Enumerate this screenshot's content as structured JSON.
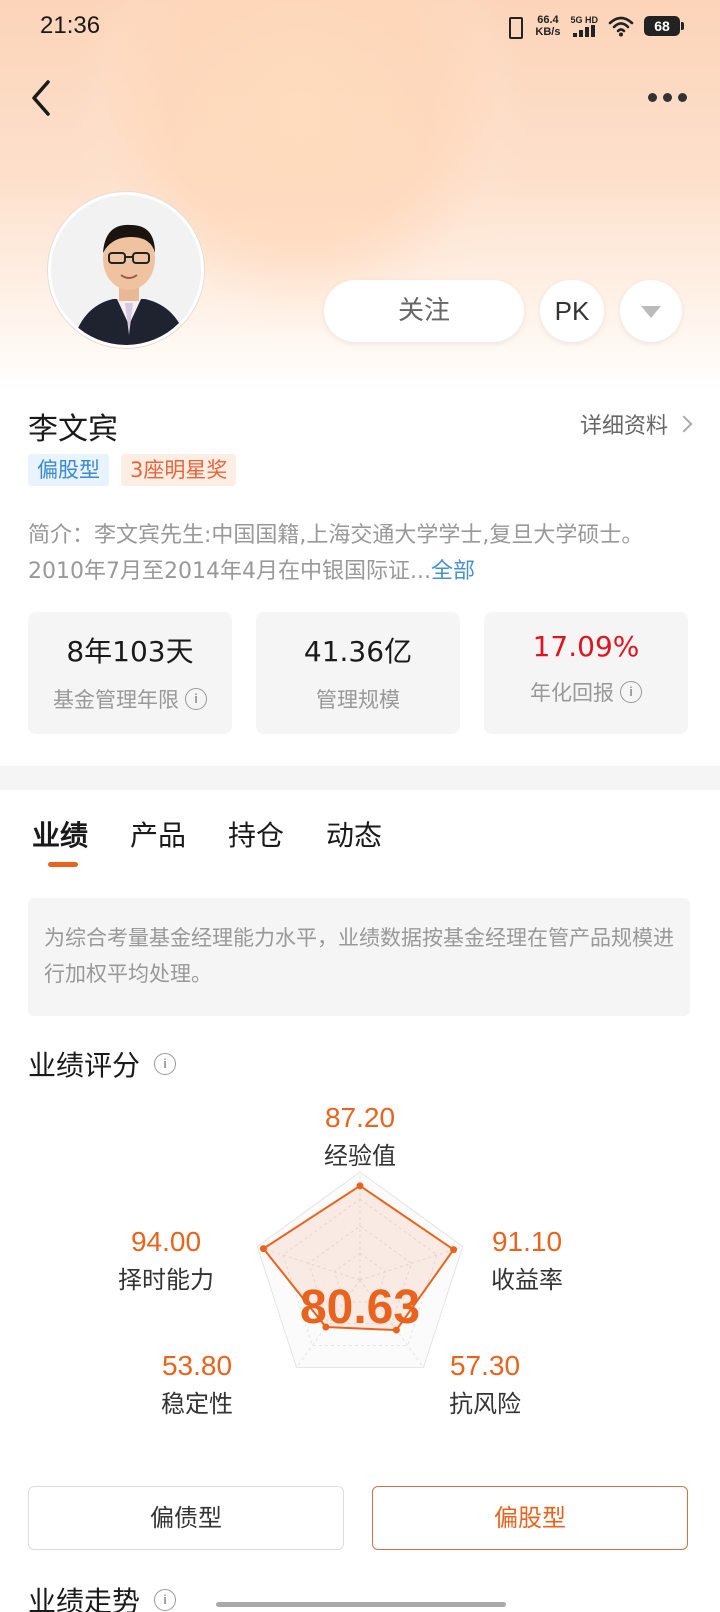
{
  "status": {
    "time": "21:36",
    "net_speed_value": "66.4",
    "net_speed_unit": "KB/s",
    "signal_label": "5G HD",
    "battery": "68"
  },
  "manager": {
    "name": "李文宾",
    "detail_link": "详细资料",
    "tags": [
      "偏股型",
      "3座明星奖"
    ],
    "intro": "简介：李文宾先生:中国国籍,上海交通大学学士,复旦大学硕士。2010年7月至2014年4月在中银国际证...",
    "intro_more": "全部"
  },
  "actions": {
    "follow": "关注",
    "pk": "PK"
  },
  "stats": [
    {
      "value": "8年103天",
      "label": "基金管理年限",
      "info": true
    },
    {
      "value": "41.36亿",
      "label": "管理规模",
      "info": false
    },
    {
      "value": "17.09%",
      "label": "年化回报",
      "info": true
    }
  ],
  "tabs": [
    "业绩",
    "产品",
    "持仓",
    "动态"
  ],
  "notice": "为综合考量基金经理能力水平，业绩数据按基金经理在管产品规模进行加权平均处理。",
  "score_section": {
    "title": "业绩评分",
    "total": "80.63",
    "dimensions": [
      {
        "label": "经验值",
        "value": "87.20",
        "score": 87.2
      },
      {
        "label": "收益率",
        "value": "91.10",
        "score": 91.1
      },
      {
        "label": "抗风险",
        "value": "57.30",
        "score": 57.3
      },
      {
        "label": "稳定性",
        "value": "53.80",
        "score": 53.8
      },
      {
        "label": "择时能力",
        "value": "94.00",
        "score": 94.0
      }
    ]
  },
  "fund_types": [
    "偏债型",
    "偏股型"
  ],
  "trend_title": "业绩走势",
  "colors": {
    "accent": "#e8641e",
    "red": "#e0141e",
    "blue_tag": "#3a8ad0"
  }
}
